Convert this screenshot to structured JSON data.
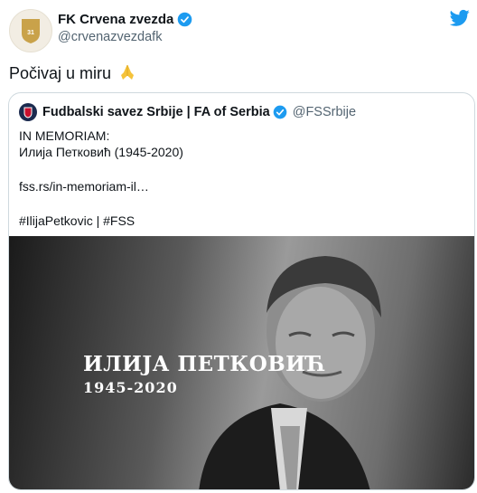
{
  "tweet": {
    "author_name": "FK Crvena zvezda",
    "author_handle": "@crvenazvezdafk",
    "text": "Počivaj u miru",
    "avatar_badge_text": "1945"
  },
  "quoted_tweet": {
    "author_name": "Fudbalski savez Srbije | FA of Serbia",
    "author_handle": "@FSSrbije",
    "lines": {
      "l1": "IN MEMORIAM:",
      "l2": "Илија Петковић (1945-2020)",
      "l3": "fss.rs/in-memoriam-il…",
      "l4": "#IlijaPetkovic | #FSS"
    },
    "image": {
      "name_overlay": "ИЛИЈА ПЕТКОВИЋ",
      "years_overlay": "1945-2020"
    }
  },
  "icons": {
    "verified": "verified-badge-icon",
    "twitter": "twitter-bird-icon",
    "pray": "folded-hands-emoji"
  },
  "colors": {
    "twitter_blue": "#1d9bf0",
    "muted_text": "#536471",
    "border": "#cfd9de"
  }
}
